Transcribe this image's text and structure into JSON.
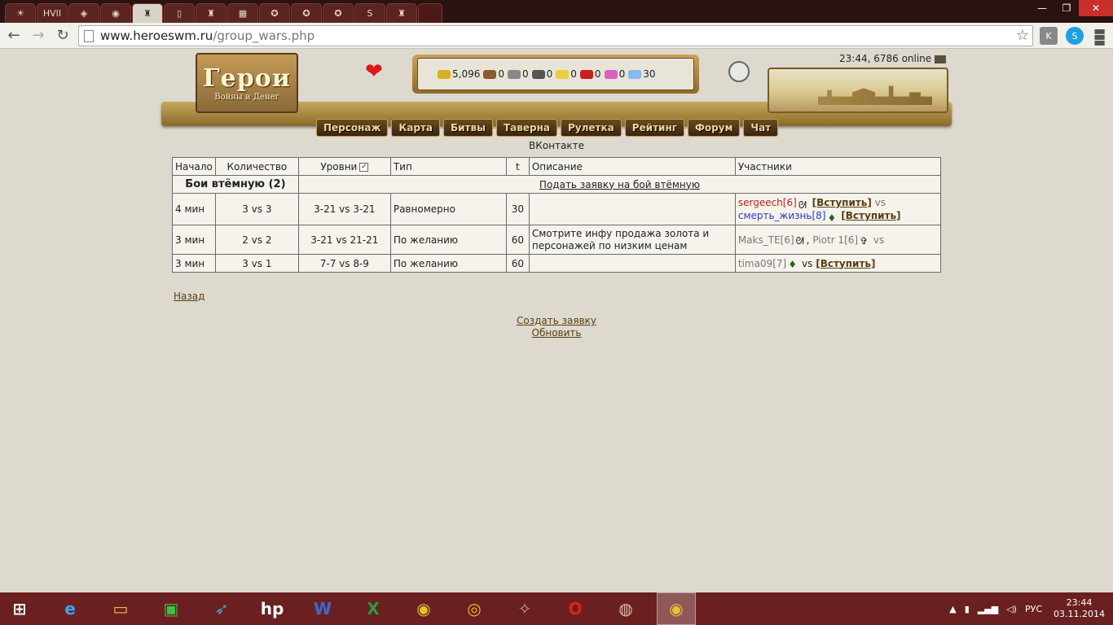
{
  "browser": {
    "tabs": [
      {
        "icon": "flame-icon",
        "label": ""
      },
      {
        "icon": "text-logo-icon",
        "label": "HVII"
      },
      {
        "icon": "shield-icon",
        "label": ""
      },
      {
        "icon": "circle-logo-icon",
        "label": ""
      },
      {
        "icon": "hero-logo-icon",
        "label": ""
      },
      {
        "icon": "page-icon",
        "label": ""
      },
      {
        "icon": "hero-logo-icon",
        "label": ""
      },
      {
        "icon": "image-icon",
        "label": ""
      },
      {
        "icon": "emblem-icon",
        "label": ""
      },
      {
        "icon": "emblem-icon",
        "label": ""
      },
      {
        "icon": "emblem-icon",
        "label": ""
      },
      {
        "icon": "s-logo-icon",
        "label": ""
      },
      {
        "icon": "hero-logo-icon",
        "label": ""
      }
    ],
    "url_host": "www.heroeswm.ru",
    "url_path": "/group_wars.php"
  },
  "header": {
    "logo_title": "Герои",
    "logo_subtitle": "Войны и Денег",
    "online": "23:44, 6786 online",
    "resources": [
      {
        "icon": "gold-icon",
        "value": "5,096",
        "color": "#d8b020"
      },
      {
        "icon": "wood-icon",
        "value": "0",
        "color": "#8a5a2a"
      },
      {
        "icon": "ore-icon",
        "value": "0",
        "color": "#888888"
      },
      {
        "icon": "mercury-icon",
        "value": "0",
        "color": "#555555"
      },
      {
        "icon": "sulfur-icon",
        "value": "0",
        "color": "#e8d040"
      },
      {
        "icon": "crystal-icon",
        "value": "0",
        "color": "#c82020"
      },
      {
        "icon": "gems-icon",
        "value": "0",
        "color": "#d860c0"
      },
      {
        "icon": "diamond-icon",
        "value": "30",
        "color": "#8ab8e8"
      }
    ],
    "menu": [
      "Персонаж",
      "Карта",
      "Битвы",
      "Таверна",
      "Рулетка",
      "Рейтинг",
      "Форум",
      "Чат"
    ],
    "vk": "ВКонтакте"
  },
  "table": {
    "headers": {
      "start": "Начало",
      "count": "Количество",
      "levels": "Уровни",
      "type": "Тип",
      "t": "t",
      "desc": "Описание",
      "participants": "Участники"
    },
    "section_title": "Бои втёмную (2)",
    "section_link": "Подать заявку на бой втёмную",
    "join_label": "[Вступить]",
    "vs": "vs",
    "rows": [
      {
        "start": "4 мин",
        "count": "3 vs 3",
        "levels": "3-21 vs 3-21",
        "type": "Равномерно",
        "t": "30",
        "desc": "",
        "p1_name": "sergeech",
        "p1_level": "[6]",
        "p2_name": "смерть_жизнь",
        "p2_level": "[8]"
      },
      {
        "start": "3 мин",
        "count": "2 vs 2",
        "levels": "3-21 vs 21-21",
        "type": "По желанию",
        "t": "60",
        "desc": "Смотрите инфу продажа золота и персонажей по низким ценам",
        "p1_name": "Maks_TE",
        "p1_level": "[6]",
        "p2_name": "Piotr 1",
        "p2_level": "[6]"
      },
      {
        "start": "3 мин",
        "count": "3 vs 1",
        "levels": "7-7 vs 8-9",
        "type": "По желанию",
        "t": "60",
        "desc": "",
        "p1_name": "tima09",
        "p1_level": "[7]"
      }
    ]
  },
  "links": {
    "back": "Назад",
    "create": "Создать заявку",
    "refresh": "Обновить"
  },
  "taskbar": {
    "lang": "РУС",
    "time": "23:44",
    "date": "03.11.2014"
  }
}
